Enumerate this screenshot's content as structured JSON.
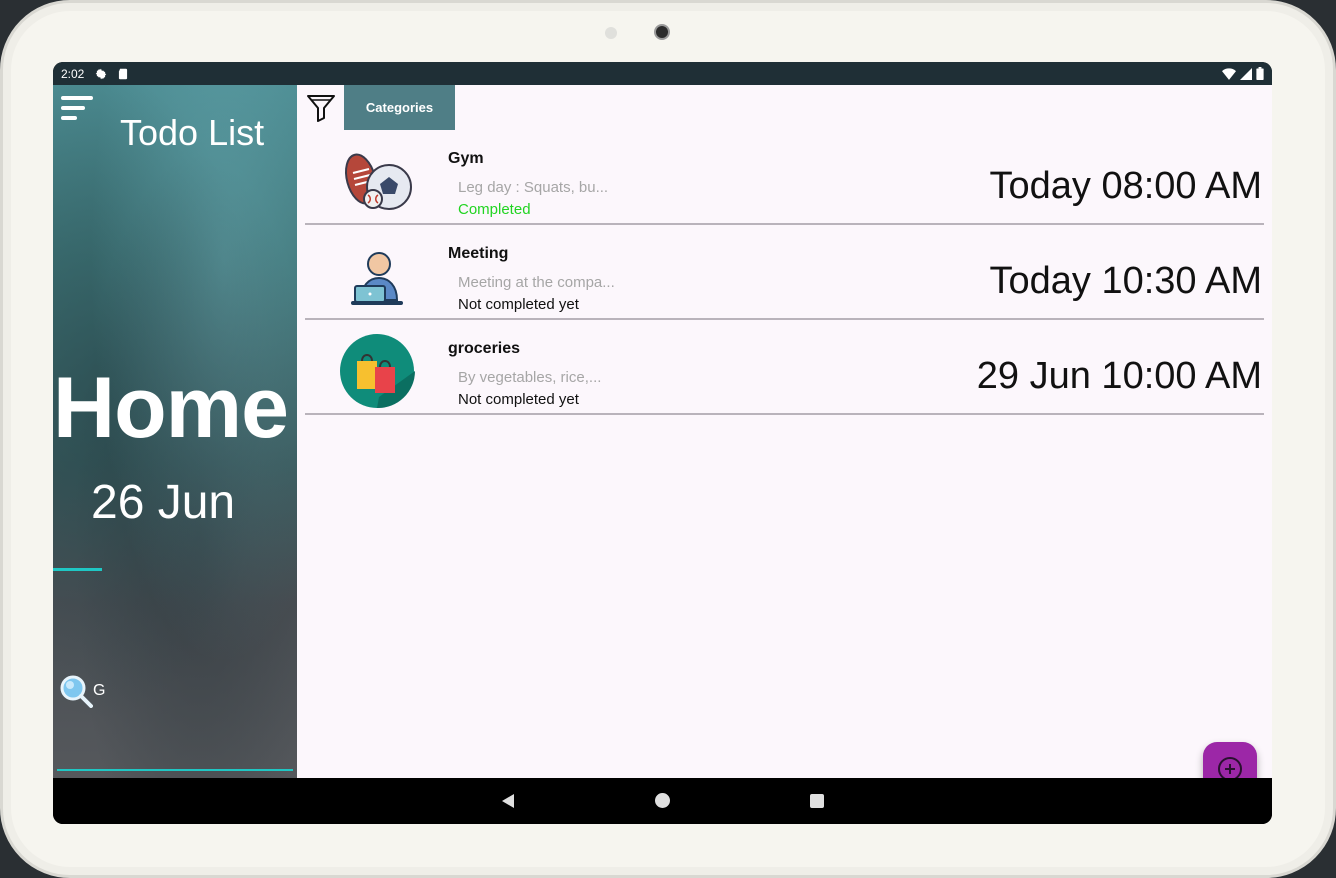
{
  "status_bar": {
    "time": "2:02",
    "left_icons": [
      "gear-icon",
      "sd-card-icon"
    ],
    "right_icons": [
      "wifi-icon",
      "signal-icon",
      "battery-icon"
    ]
  },
  "sidebar": {
    "app_title": "Todo List",
    "section_title": "Home",
    "date": "26 Jun",
    "search_value": "G",
    "accent_color": "#1fc7c4"
  },
  "toolbar": {
    "filter_icon": "filter-icon",
    "categories_label": "Categories"
  },
  "tasks": [
    {
      "title": "Gym",
      "description": "Leg day : Squats, bu...",
      "status": "Completed",
      "completed": true,
      "time": "Today 08:00 AM",
      "icon": "sports-balls-icon"
    },
    {
      "title": "Meeting",
      "description": "Meeting at the compa...",
      "status": "Not completed yet",
      "completed": false,
      "time": "Today 10:30 AM",
      "icon": "person-laptop-icon"
    },
    {
      "title": "groceries",
      "description": "By vegetables, rice,...",
      "status": "Not completed yet",
      "completed": false,
      "time": "29 Jun 10:00 AM",
      "icon": "shopping-bags-icon"
    }
  ],
  "fab": {
    "icon": "add-circle-icon",
    "color": "#9c27a7"
  },
  "nav_bar": {
    "icons": [
      "back-icon",
      "home-icon",
      "recents-icon"
    ]
  },
  "colors": {
    "status_bar": "#1f2f36",
    "main_bg": "#fcf7fc",
    "categories_tab": "#4f7e86",
    "completed_text": "#22d422"
  }
}
